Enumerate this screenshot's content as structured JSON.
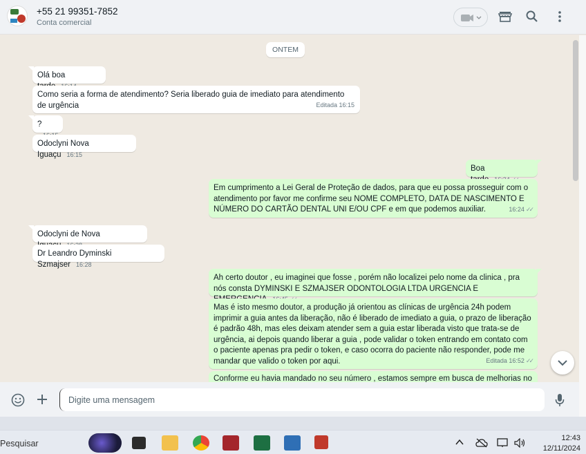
{
  "header": {
    "contact_name": "+55 21 99351-7852",
    "contact_subtitle": "Conta comercial",
    "icons": [
      "video-call-icon",
      "chevron-down-icon",
      "store-icon",
      "search-icon",
      "menu-icon"
    ]
  },
  "chat": {
    "day_label": "ONTEM",
    "messages": [
      {
        "dir": "in",
        "text": "Olá boa tarde",
        "time": "16:14"
      },
      {
        "dir": "in",
        "text": "Como seria  a forma de atendimento? Seria liberado guia de imediato para atendimento de urgência",
        "time": "Editada 16:15"
      },
      {
        "dir": "in",
        "text": "?",
        "time": "16:15"
      },
      {
        "dir": "in",
        "text": "Odoclyni Nova Iguaçu",
        "time": "16:15"
      },
      {
        "dir": "out",
        "text": "Boa tarde",
        "time": "16:24"
      },
      {
        "dir": "out",
        "text": "Em cumprimento a Lei Geral de Proteção de dados, para que eu possa prosseguir com o atendimento por favor me confirme seu NOME COMPLETO, DATA DE NASCIMENTO E NÚMERO DO CARTÃO DENTAL UNI E/OU CPF e em que podemos auxiliar.",
        "time": "16:24"
      },
      {
        "dir": "in",
        "text": "Odoclyni de Nova Iguaçu",
        "time": "16:28"
      },
      {
        "dir": "in",
        "text": "Dr Leandro Dyminski Szmajser",
        "time": "16:28"
      },
      {
        "dir": "out",
        "text": "Ah certo doutor , eu imaginei que fosse , porém não localizei pelo nome da clinica , pra nós consta DYMINSKI E SZMAJSER ODONTOLOGIA LTDA URGENCIA E EMERGENCIA",
        "time": "16:45"
      },
      {
        "dir": "out",
        "text": "Mas é isto mesmo doutor, a produção já orientou as clínicas de urgência 24h podem imprimir a guia antes da liberação, não é liberado de imediato a guia, o prazo de liberação é padrão 48h,  mas eles deixam atender sem a guia estar liberada visto que trata-se de urgência, ai depois quando liberar a guia , pode validar o token entrando em contato com o paciente apenas pra pedir o token, e caso ocorra do paciente não responder, pode me mandar que valido o token por aqui.",
        "time": "Editada 16:52"
      },
      {
        "dir": "out",
        "text": "Conforme eu havia mandado no seu número , estamos sempre em busca de melhorias no",
        "time": ""
      }
    ]
  },
  "composer": {
    "placeholder": "Digite uma mensagem"
  },
  "taskbar": {
    "search_label": "Pesquisar",
    "time": "12:43",
    "date": "12/11/2024"
  },
  "colors": {
    "incoming_bubble": "#ffffff",
    "outgoing_bubble": "#d9fdd3",
    "chat_background": "#efeae2",
    "header_background": "#f0f2f5"
  }
}
